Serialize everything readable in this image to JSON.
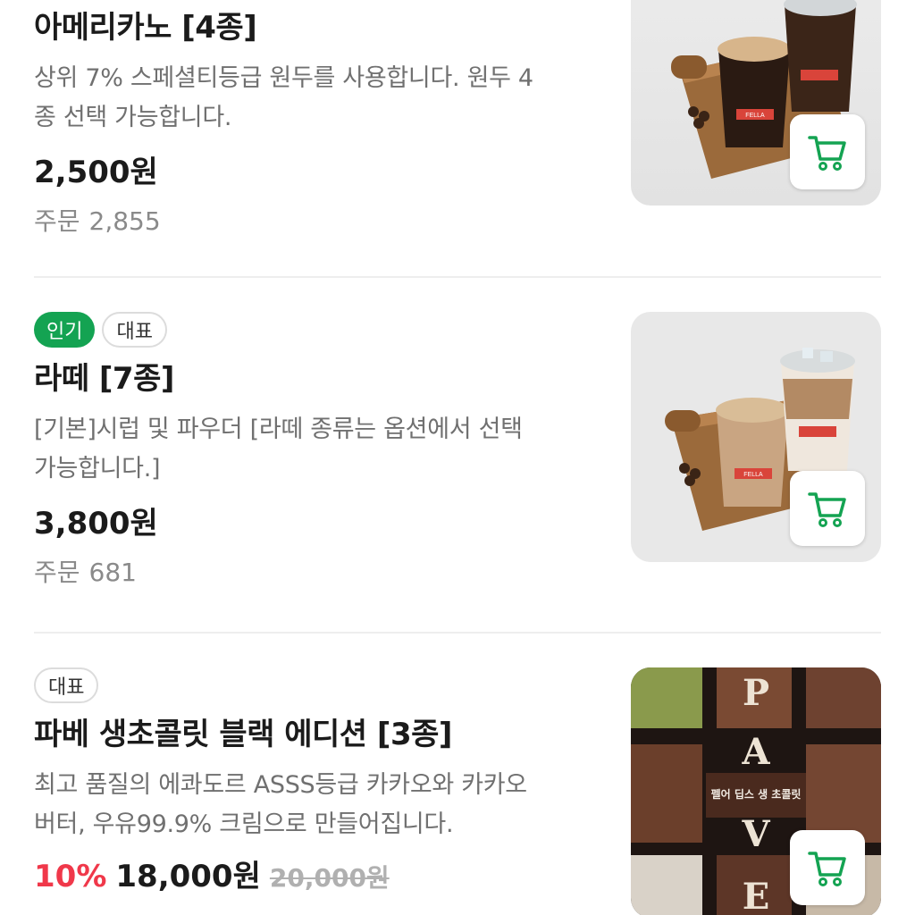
{
  "items": [
    {
      "badges": [],
      "title": "아메리카노 [4종]",
      "desc_line1": "상위 7% 스페셜티등급 원두를 사용합니다. 원두 4",
      "desc_line2": "종 선택 가능합니다.",
      "price": "2,500원",
      "orders_label": "주문",
      "orders_count": "2,855",
      "image_text": "FELLA",
      "cart_icon": "cart-icon"
    },
    {
      "badges": [
        "인기",
        "대표"
      ],
      "title": "라떼 [7종]",
      "desc_line1": "[기본]시럽 및 파우더 [라떼 종류는 옵션에서 선택",
      "desc_line2": "가능합니다.]",
      "price": "3,800원",
      "orders_label": "주문",
      "orders_count": "681",
      "image_text": "FELLA",
      "cart_icon": "cart-icon"
    },
    {
      "badges": [
        "대표"
      ],
      "title": "파베 생초콜릿 블랙 에디션 [3종]",
      "desc_line1": "최고 품질의 에콰도르 ASSS등급 카카오와 카카오",
      "desc_line2": "버터, 우유99.9% 크림으로 만들어집니다.",
      "discount": "10%",
      "price": "18,000원",
      "original_price": "20,000원",
      "image_text": "펠어 딥스 생 초콜릿",
      "image_letters": [
        "P",
        "A",
        "V",
        "E"
      ],
      "cart_icon": "cart-icon"
    }
  ],
  "colors": {
    "accent_green": "#14a352",
    "discount_red": "#f0384a"
  }
}
